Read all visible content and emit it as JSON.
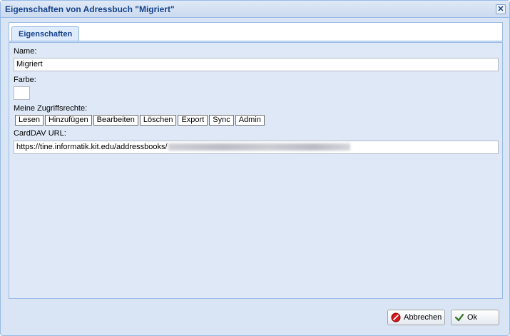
{
  "window": {
    "title": "Eigenschaften von Adressbuch \"Migriert\""
  },
  "tabs": [
    {
      "label": "Eigenschaften"
    }
  ],
  "form": {
    "name_label": "Name:",
    "name_value": "Migriert",
    "color_label": "Farbe:",
    "color_value": "#ffffff",
    "rights_label": "Meine Zugriffsrechte:",
    "rights": [
      "Lesen",
      "Hinzufügen",
      "Bearbeiten",
      "Löschen",
      "Export",
      "Sync",
      "Admin"
    ],
    "carddav_label": "CardDAV URL:",
    "carddav_value": "https://tine.informatik.kit.edu/addressbooks/"
  },
  "buttons": {
    "cancel_label": "Abbrechen",
    "ok_label": "Ok"
  },
  "icons": {
    "close": "close-icon",
    "cancel": "cancel-icon",
    "ok": "checkmark-icon"
  }
}
